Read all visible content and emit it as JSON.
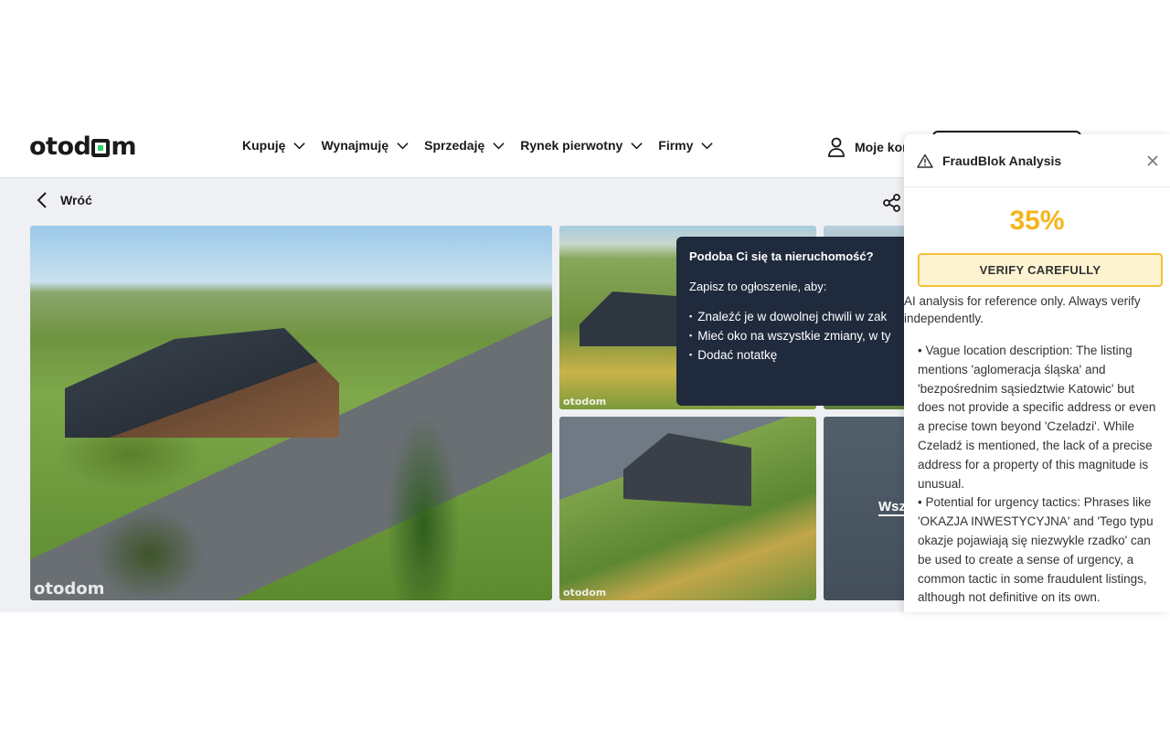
{
  "header": {
    "logo": "otodom",
    "nav": [
      {
        "label": "Kupuję"
      },
      {
        "label": "Wynajmuję"
      },
      {
        "label": "Sprzedaję"
      },
      {
        "label": "Rynek pierwotny"
      },
      {
        "label": "Firmy"
      }
    ],
    "account_label": "Moje kon"
  },
  "back_label": "Wróć",
  "gallery": {
    "watermark": "otodom",
    "see_all_label": "Wsz"
  },
  "tooltip": {
    "title": "Podoba Ci się ta nieruchomość?",
    "subtitle": "Zapisz to ogłoszenie, aby:",
    "items": [
      "Znaleźć je w dowolnej chwili w zak",
      "Mieć oko na wszystkie zmiany, w ty",
      "Dodać notatkę"
    ]
  },
  "fraudblok": {
    "title": "FraudBlok Analysis",
    "score": "35%",
    "verdict": "VERIFY CAREFULLY",
    "disclaimer": "AI analysis for reference only. Always verify independently.",
    "findings": [
      "• Vague location description: The listing mentions 'aglomeracja śląska' and 'bezpośrednim sąsiedztwie Katowic' but does not provide a specific address or even a precise town beyond 'Czeladzi'. While Czeladź is mentioned, the lack of a precise address for a property of this magnitude is unusual.",
      "• Potential for urgency tactics: Phrases like 'OKAZJA INWESTYCYJNA' and 'Tego typu okazje pojawiają się niezwykle rzadko' can be used to create a sense of urgency, a common tactic in some fraudulent listings, although not definitive on its own."
    ],
    "colors": {
      "score": "#f5b41a",
      "verdict_border": "#f5c036",
      "verdict_bg": "#fdf3d1"
    }
  }
}
